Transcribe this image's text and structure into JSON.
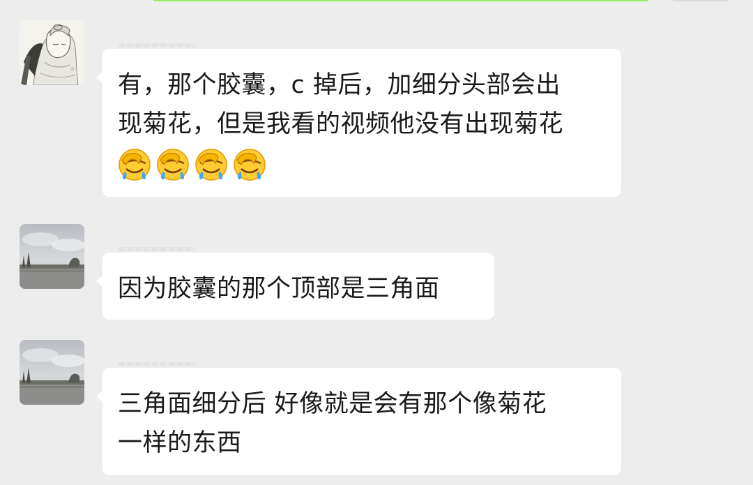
{
  "chat": {
    "messages": [
      {
        "sender": "contact-a",
        "lines": [
          "有，那个胶囊，c 掉后，加细分头部会出",
          "现菊花，但是我看的视频他没有出现菊花"
        ],
        "emojis": [
          "facepalm-emoji",
          "facepalm-emoji",
          "facepalm-emoji",
          "facepalm-emoji"
        ]
      },
      {
        "sender": "contact-b",
        "lines": [
          "因为胶囊的那个顶部是三角面"
        ]
      },
      {
        "sender": "contact-b",
        "lines": [
          "三角面细分后 好像就是会有那个像菊花",
          "一样的东西"
        ]
      }
    ]
  },
  "colors": {
    "background": "#ededed",
    "bubble": "#ffffff",
    "text": "#1a1a1a",
    "self_bubble_green": "#95ec69"
  }
}
